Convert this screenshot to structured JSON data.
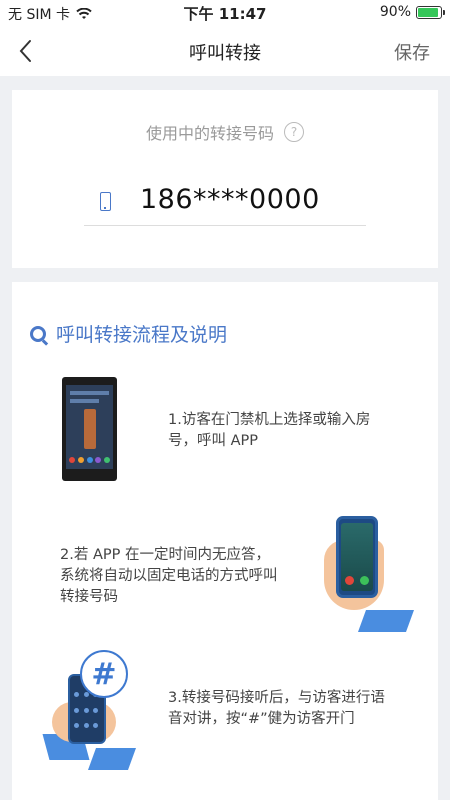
{
  "status_bar": {
    "carrier": "无 SIM 卡",
    "time": "下午 11:47",
    "battery": "90%",
    "battery_level": 0.9
  },
  "nav": {
    "title": "呼叫转接",
    "save_label": "保存"
  },
  "forward": {
    "label": "使用中的转接号码",
    "help": "?",
    "number": "186****0000"
  },
  "instructions": {
    "title": "呼叫转接流程及说明",
    "steps": [
      {
        "text": "1.访客在门禁机上选择或输入房号，呼叫 APP"
      },
      {
        "text": "2.若 APP 在一定时间内无应答，系统将自动以固定电话的方式呼叫转接号码"
      },
      {
        "text": "3.转接号码接听后，与访客进行语音对讲，按“#”健为访客开门"
      }
    ],
    "hash_symbol": "#"
  },
  "colors": {
    "accent": "#4a78c8",
    "battery_fill": "#35c759"
  }
}
